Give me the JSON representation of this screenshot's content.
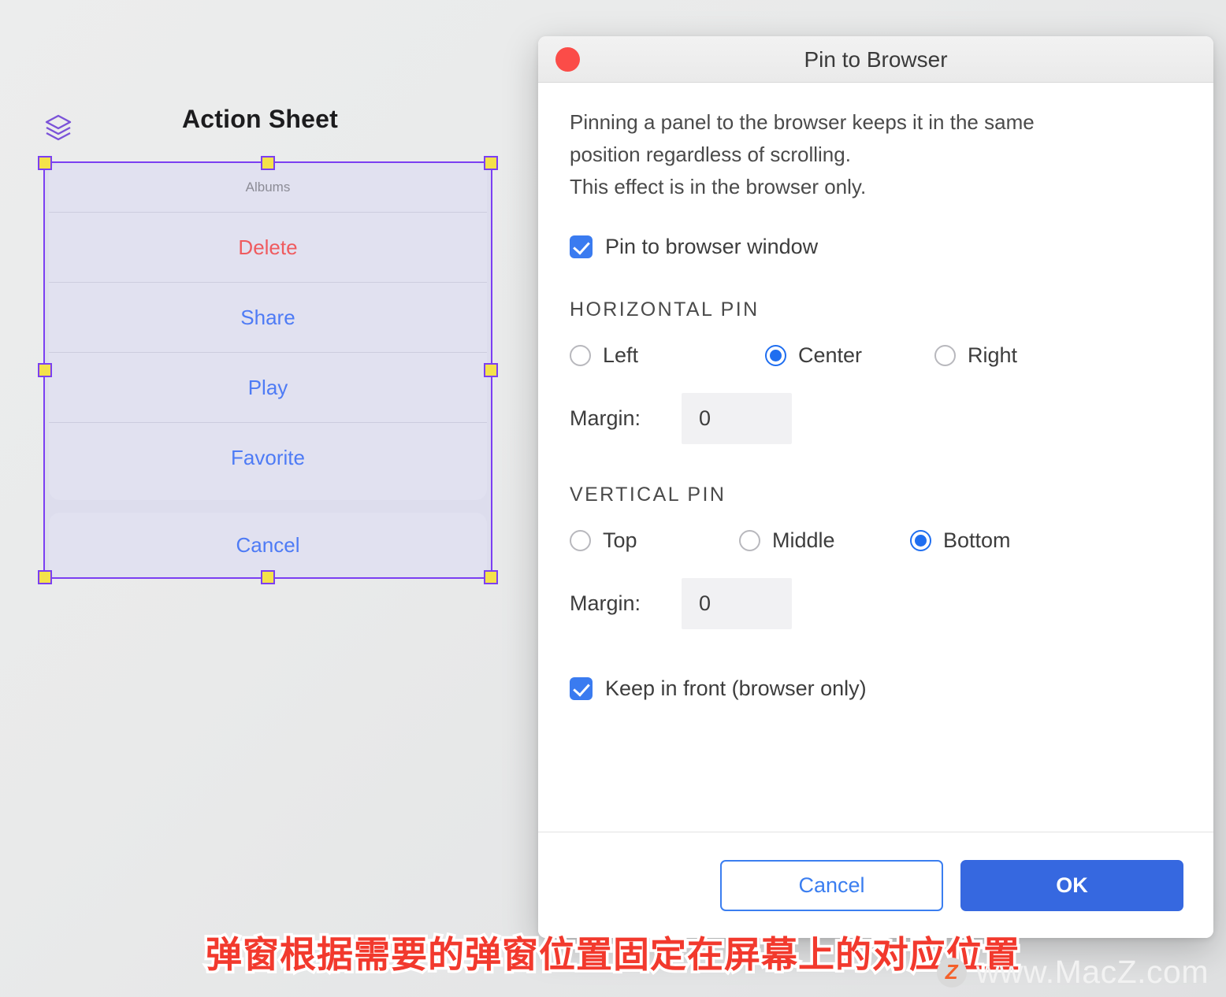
{
  "canvas": {
    "layers_icon": "layers-icon",
    "title": "Action Sheet",
    "action_sheet": {
      "header": "Albums",
      "items": [
        {
          "label": "Delete",
          "style": "destructive"
        },
        {
          "label": "Share",
          "style": "default"
        },
        {
          "label": "Play",
          "style": "default"
        },
        {
          "label": "Favorite",
          "style": "default"
        }
      ],
      "cancel": "Cancel"
    },
    "selection_handles": 8
  },
  "dialog": {
    "title": "Pin to Browser",
    "close_icon": "close-icon",
    "description_lines": [
      "Pinning a panel to the browser keeps it in the same",
      "position regardless of scrolling.",
      "This effect is in the browser only."
    ],
    "pin_checkbox": {
      "label": "Pin to browser window",
      "checked": true
    },
    "horizontal": {
      "section_title": "HORIZONTAL PIN",
      "options": [
        "Left",
        "Center",
        "Right"
      ],
      "selected": "Center",
      "margin_label": "Margin:",
      "margin_value": "0"
    },
    "vertical": {
      "section_title": "VERTICAL PIN",
      "options": [
        "Top",
        "Middle",
        "Bottom"
      ],
      "selected": "Bottom",
      "margin_label": "Margin:",
      "margin_value": "0"
    },
    "keep_front_checkbox": {
      "label": "Keep in front (browser only)",
      "checked": true
    },
    "buttons": {
      "cancel": "Cancel",
      "ok": "OK"
    }
  },
  "caption": "弹窗根据需要的弹窗位置固定在屏幕上的对应位置",
  "watermark": {
    "logo": "Z",
    "text": "www.MacZ.com"
  },
  "colors": {
    "accent_blue": "#3668e0",
    "link_blue": "#4e7bf5",
    "destructive_red": "#ef5b5f",
    "selection_purple": "#7b3ff2",
    "handle_yellow": "#f4e24a",
    "close_red": "#fb4c48",
    "caption_red": "#f2392d"
  }
}
